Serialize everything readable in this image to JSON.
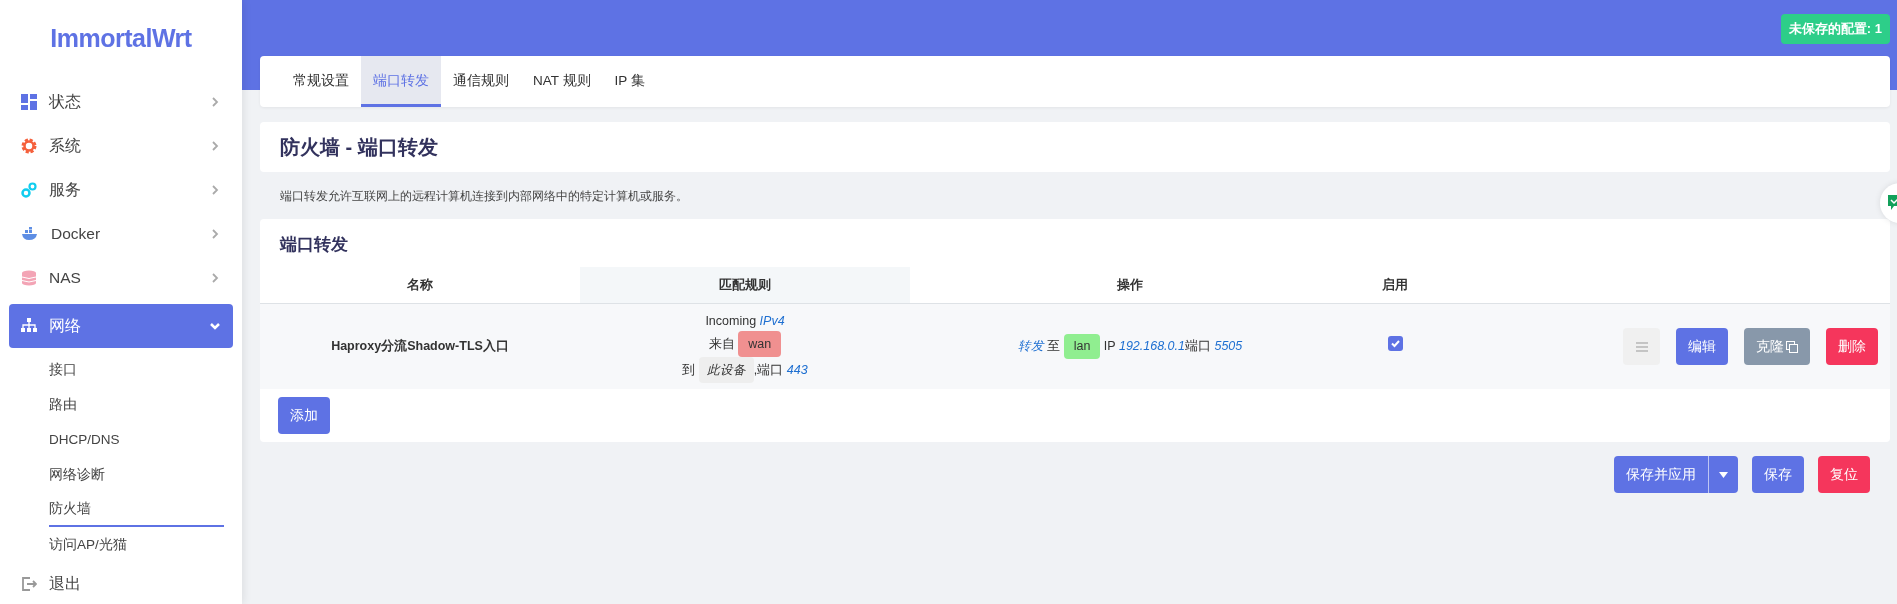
{
  "sidebar": {
    "logo": "ImmortalWrt",
    "items": [
      {
        "label": "状态",
        "expanded": false,
        "selected": false
      },
      {
        "label": "系统",
        "expanded": false,
        "selected": false
      },
      {
        "label": "服务",
        "expanded": false,
        "selected": false
      },
      {
        "label": "Docker",
        "expanded": false,
        "selected": false
      },
      {
        "label": "NAS",
        "expanded": false,
        "selected": false
      },
      {
        "label": "网络",
        "expanded": true,
        "selected": true,
        "children": [
          {
            "label": "接口",
            "selected": false
          },
          {
            "label": "路由",
            "selected": false
          },
          {
            "label": "DHCP/DNS",
            "selected": false
          },
          {
            "label": "网络诊断",
            "selected": false
          },
          {
            "label": "防火墙",
            "selected": true
          },
          {
            "label": "访问AP/光猫",
            "selected": false
          }
        ]
      }
    ],
    "logout": "退出"
  },
  "unsaved_badge": "未保存的配置: 1",
  "tabs": [
    {
      "label": "常规设置",
      "selected": false
    },
    {
      "label": "端口转发",
      "selected": true
    },
    {
      "label": "通信规则",
      "selected": false
    },
    {
      "label": "NAT 规则",
      "selected": false
    },
    {
      "label": "IP 集",
      "selected": false
    }
  ],
  "page_title": "防火墙 - 端口转发",
  "description": "端口转发允许互联网上的远程计算机连接到内部网络中的特定计算机或服务。",
  "section": {
    "title": "端口转发",
    "table": {
      "columns": [
        "名称",
        "匹配规则",
        "操作",
        "启用"
      ],
      "rows": [
        {
          "name": "Haproxy分流Shadow-TLS入口",
          "match": {
            "direction": "Incoming",
            "family": "IPv4",
            "from_label": "来自",
            "from_zone": {
              "name": "wan",
              "color": "#f09090"
            },
            "to_label": "到",
            "to_device": "此设备",
            "port_label": ",端口",
            "port": "443"
          },
          "action": {
            "verb": "转发",
            "to_label": "至",
            "zone": {
              "name": "lan",
              "color": "#90ee90"
            },
            "ip_label": "IP",
            "ip": "192.168.0.1",
            "port_label": "端口",
            "port": "5505"
          },
          "enabled": true,
          "buttons": [
            {
              "label": "编辑",
              "kind": "edit"
            },
            {
              "label": "克隆",
              "kind": "clone"
            },
            {
              "label": "删除",
              "kind": "delete"
            }
          ]
        }
      ]
    },
    "add_button": "添加"
  },
  "footer_buttons": [
    {
      "label": "保存并应用",
      "kind": "apply"
    },
    {
      "label": "保存",
      "kind": "save"
    },
    {
      "label": "复位",
      "kind": "reset"
    }
  ]
}
